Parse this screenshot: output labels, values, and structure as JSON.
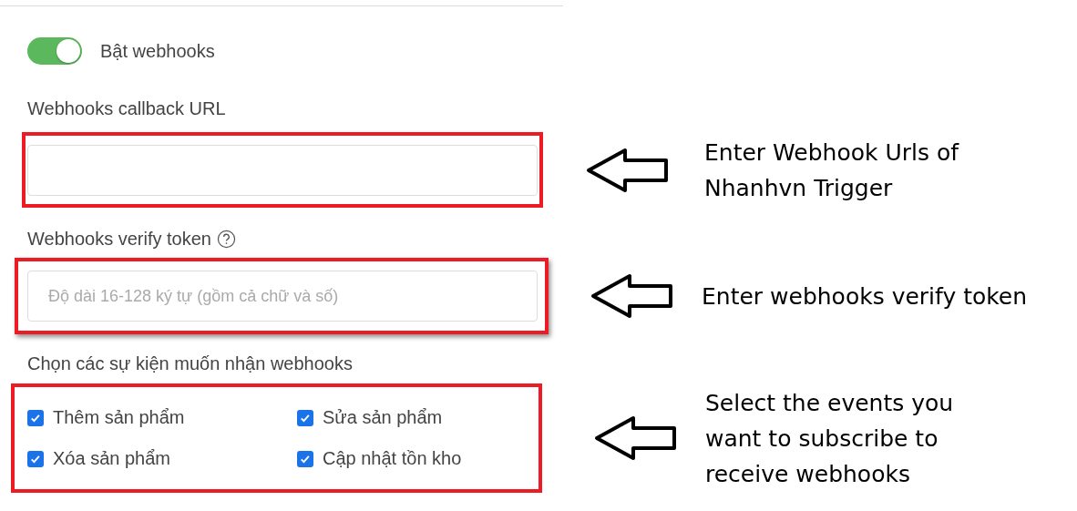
{
  "toggle": {
    "label": "Bật webhooks",
    "on": true
  },
  "callback_url": {
    "label": "Webhooks callback URL"
  },
  "verify_token": {
    "label": "Webhooks verify token",
    "placeholder": "Độ dài 16-128 ký tự (gồm cả chữ và số)"
  },
  "events": {
    "label": "Chọn các sự kiện muốn nhận webhooks",
    "options": [
      {
        "label": "Thêm sản phẩm",
        "checked": true
      },
      {
        "label": "Sửa sản phẩm",
        "checked": true
      },
      {
        "label": "Xóa sản phẩm",
        "checked": true
      },
      {
        "label": "Cập nhật tồn kho",
        "checked": true
      }
    ]
  },
  "annotations": [
    {
      "lines": [
        "Enter Webhook Urls of",
        "Nhanhvn Trigger"
      ]
    },
    {
      "lines": [
        "Enter webhooks verify token"
      ]
    },
    {
      "lines": [
        "Select the events you",
        "want to subscribe to",
        "receive webhooks"
      ]
    }
  ]
}
